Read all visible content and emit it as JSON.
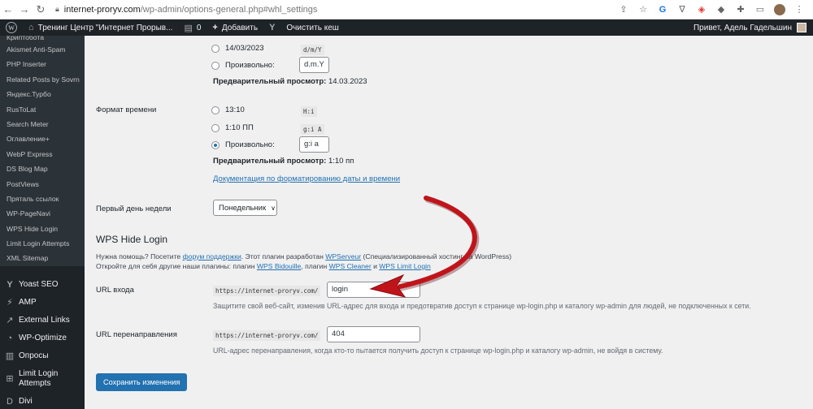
{
  "browser": {
    "url_host": "internet-proryv.com",
    "url_path": "/wp-admin/options-general.php#whl_settings"
  },
  "adminbar": {
    "site_name": "Тренинг Центр \"Интернет Прорыв...",
    "comments_count": "0",
    "add_label": "Добавить",
    "cache_label": "Очистить кеш",
    "greeting": "Привет, Адель Гадельшин"
  },
  "sidebar": {
    "cut_item": "Криптобота",
    "subitems": [
      "Akismet Anti-Spam",
      "PHP Inserter",
      "Related Posts by Sovrn",
      "Яндекс.Турбо",
      "RusToLat",
      "Search Meter",
      "Оглавление+",
      "WebP Express",
      "DS Blog Map",
      "PostViews",
      "Пряталь ссылок",
      "WP-PageNavi",
      "WPS Hide Login",
      "Limit Login Attempts",
      "XML Sitemap"
    ],
    "main_items": [
      {
        "label": "Yoast SEO",
        "icon": "yoast-icon"
      },
      {
        "label": "AMP",
        "icon": "amp-icon"
      },
      {
        "label": "External Links",
        "icon": "external-links-icon"
      },
      {
        "label": "WP-Optimize",
        "icon": "wp-optimize-icon"
      },
      {
        "label": "Опросы",
        "icon": "polls-icon"
      },
      {
        "label": "Limit Login",
        "label2": "Attempts",
        "icon": "limit-login-icon"
      },
      {
        "label": "Divi",
        "icon": "divi-icon"
      }
    ]
  },
  "date_format": {
    "option1_label": "14/03/2023",
    "option1_code": "d/m/Y",
    "custom_label": "Произвольно:",
    "custom_value": "d.m.Y",
    "preview_label": "Предварительный просмотр:",
    "preview_value": "14.03.2023"
  },
  "time_format": {
    "label": "Формат времени",
    "option1_label": "13:10",
    "option1_code": "H:i",
    "option2_label": "1:10 ПП",
    "option2_code": "g:i A",
    "custom_label": "Произвольно:",
    "custom_value": "g:i a",
    "preview_label": "Предварительный просмотр:",
    "preview_value": "1:10 пп",
    "doc_link": "Документация по форматированию даты и времени"
  },
  "week_start": {
    "label": "Первый день недели",
    "value": "Понедельник"
  },
  "wps_hide_login": {
    "title": "WPS Hide Login",
    "help_line1_a": "Нужна помощь? Посетите ",
    "help_link_forum": "форум поддержки",
    "help_line1_b": ". Этот плагин разработан ",
    "help_link_wpserveur": "WPServeur",
    "help_line1_c": " (Специализированный хостинг на WordPress)",
    "help_line2_a": "Откройте для себя другие наши плагины: плагин ",
    "help_link_bidouille": "WPS Bidouille",
    "help_line2_b": ", плагин ",
    "help_link_cleaner": "WPS Cleaner",
    "help_line2_c": " и ",
    "help_link_limit": "WPS Limit Login",
    "login_url_label": "URL входа",
    "login_url_prefix": "https://internet-proryv.com/",
    "login_url_value": "login",
    "login_url_desc": "Защитите свой веб-сайт, изменив URL-адрес для входа и предотвратив доступ к странице wp-login.php и каталогу wp-admin для людей, не подключенных к сети.",
    "redirect_label": "URL перенаправления",
    "redirect_prefix": "https://internet-proryv.com/",
    "redirect_value": "404",
    "redirect_desc": "URL-адрес перенаправления, когда кто-то пытается получить доступ к странице wp-login.php и каталогу wp-admin, не войдя в систему."
  },
  "save_button": "Сохранить изменения",
  "colors": {
    "accent": "#2271b1",
    "sidebar_bg": "#2c3338",
    "adminbar_bg": "#1d2327",
    "arrow": "#c0141b"
  }
}
